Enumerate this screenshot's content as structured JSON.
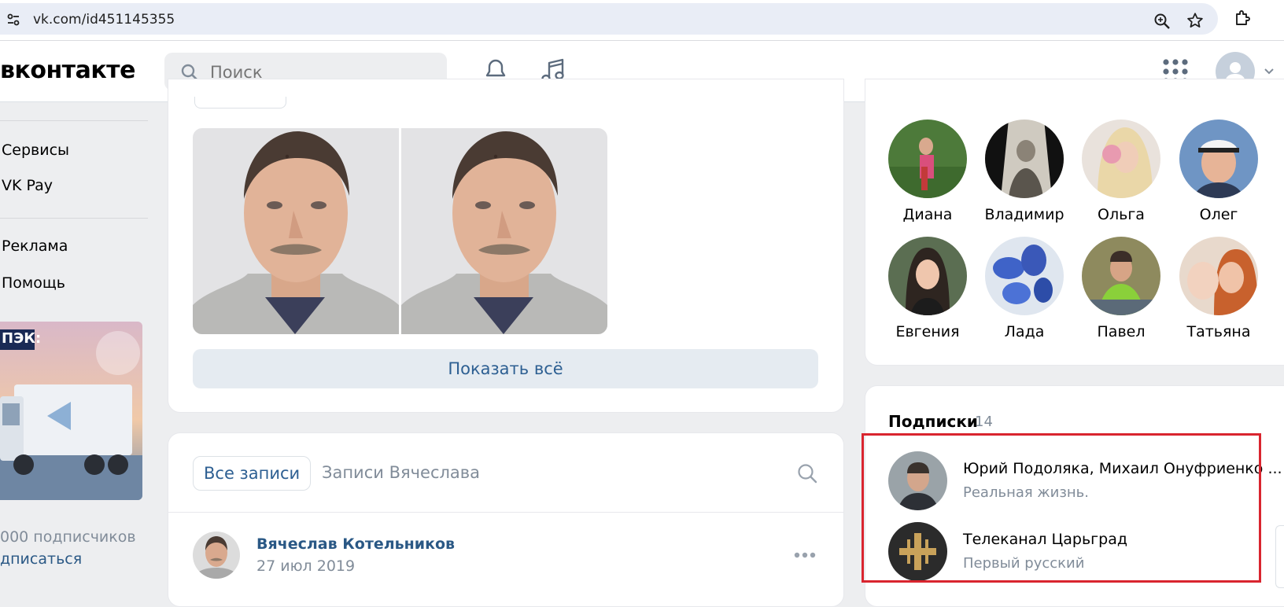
{
  "browser": {
    "url": "vk.com/id451145355"
  },
  "header": {
    "logo": "вконтакте",
    "search_placeholder": "Поиск"
  },
  "left_nav": {
    "items": [
      "Сервисы",
      "VK Pay",
      "Реклама",
      "Помощь"
    ],
    "ad": {
      "brand": "ПЭК:",
      "subscribers": "000 подписчиков",
      "subscribe_link": "дписаться"
    }
  },
  "photos": {
    "show_all_label": "Показать всё"
  },
  "wall": {
    "tab_all": "Все записи",
    "tab_owner": "Записи Вячеслава",
    "post": {
      "author": "Вячеслав Котельников",
      "date": "27 июл 2019"
    }
  },
  "friends": {
    "names": [
      "Диана",
      "Владимир",
      "Ольга",
      "Олег",
      "Евгения",
      "Лада",
      "Павел",
      "Татьяна"
    ]
  },
  "subscriptions": {
    "title": "Подписки",
    "count": "14",
    "items": [
      {
        "name": "Юрий Подоляка, Михаил Онуфриенко ...",
        "desc": "Реальная жизнь."
      },
      {
        "name": "Телеканал Царьград",
        "desc": "Первый русский"
      }
    ]
  },
  "colors": {
    "accent_link": "#2a5885",
    "highlight_border": "#d9252f"
  }
}
